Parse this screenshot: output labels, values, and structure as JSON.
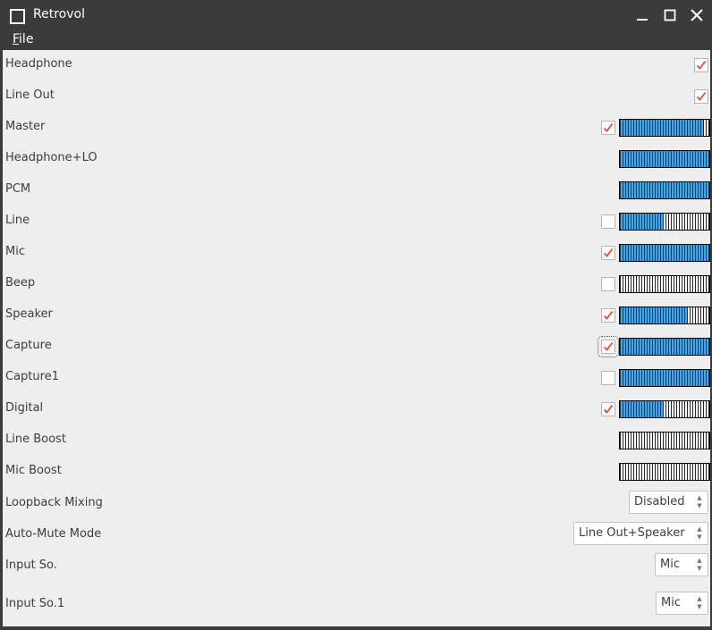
{
  "window": {
    "title": "Retrovol"
  },
  "menu": {
    "file_label": "File",
    "file_mnemonic": "F",
    "file_rest": "ile"
  },
  "controls": [
    {
      "label": "Headphone",
      "checkbox": true,
      "checked": true,
      "level": null
    },
    {
      "label": "Line Out",
      "checkbox": true,
      "checked": true,
      "level": null
    },
    {
      "label": "Master",
      "checkbox": true,
      "checked": true,
      "level": 0.93
    },
    {
      "label": "Headphone+LO",
      "checkbox": false,
      "checked": null,
      "level": 1.0
    },
    {
      "label": "PCM",
      "checkbox": false,
      "checked": null,
      "level": 1.0
    },
    {
      "label": "Line",
      "checkbox": true,
      "checked": false,
      "level": 0.49
    },
    {
      "label": "Mic",
      "checkbox": true,
      "checked": true,
      "level": 1.0
    },
    {
      "label": "Beep",
      "checkbox": true,
      "checked": false,
      "level": 0.0
    },
    {
      "label": "Speaker",
      "checkbox": true,
      "checked": true,
      "level": 0.76
    },
    {
      "label": "Capture",
      "checkbox": true,
      "checked": true,
      "level": 1.0,
      "focused": true
    },
    {
      "label": "Capture1",
      "checkbox": true,
      "checked": false,
      "level": 1.0
    },
    {
      "label": "Digital",
      "checkbox": true,
      "checked": true,
      "level": 0.49
    },
    {
      "label": "Line Boost",
      "checkbox": false,
      "checked": null,
      "level": 0.0
    },
    {
      "label": "Mic Boost",
      "checkbox": false,
      "checked": null,
      "level": 0.0
    }
  ],
  "selects": [
    {
      "label": "Loopback Mixing",
      "value": "Disabled"
    },
    {
      "label": "Auto-Mute Mode",
      "value": "Line Out+Speaker"
    },
    {
      "label": "Input So.",
      "value": "Mic"
    },
    {
      "label": "Input So.1",
      "value": "Mic"
    }
  ],
  "colors": {
    "titlebar": "#3b3b3b",
    "content_bg": "#eeeeee",
    "level_fill": "#3fa6e8",
    "check_mark": "#e04b3a"
  },
  "icons": {
    "minimize": "minimize-icon",
    "maximize": "maximize-icon",
    "close": "close-icon",
    "check": "check-icon",
    "spin": "up-down-arrows-icon"
  }
}
